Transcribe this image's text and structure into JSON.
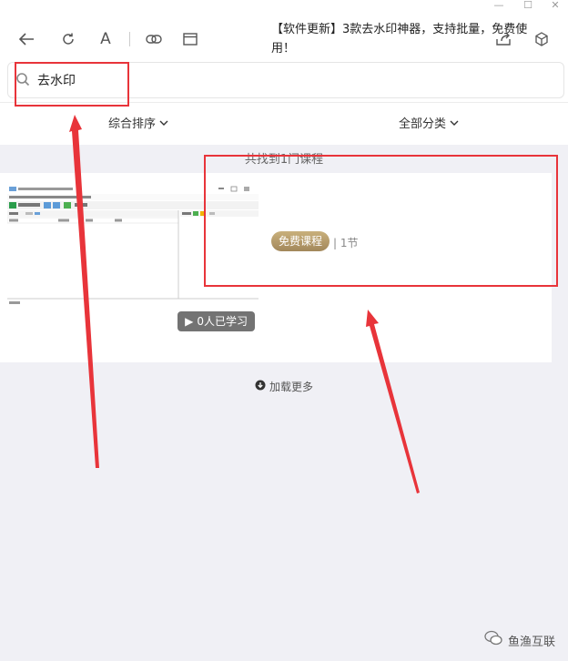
{
  "search": {
    "query": "去水印"
  },
  "filters": {
    "sort_label": "综合排序",
    "category_label": "全部分类"
  },
  "results": {
    "count_text": "共找到1门课程"
  },
  "course": {
    "title": "【软件更新】3款去水印神器，支持批量，免费使用！",
    "price_label": "免费课程",
    "sections_text": "| 1节",
    "learners_text": "0人已学习"
  },
  "load_more_label": "加载更多",
  "watermark": {
    "text": "鱼渔互联"
  },
  "colors": {
    "annotation_red": "#e8343a",
    "price_gold": "#b39868",
    "page_bg": "#f0f0f5"
  }
}
